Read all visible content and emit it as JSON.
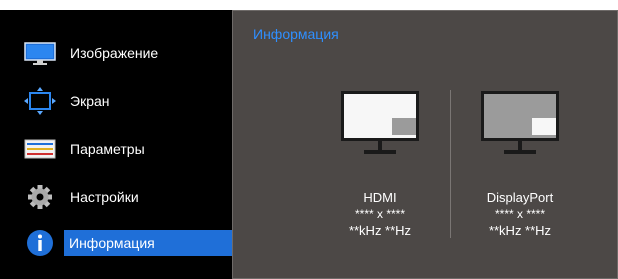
{
  "menu": {
    "items": [
      {
        "label": "Изображение",
        "icon": "display-icon"
      },
      {
        "label": "Экран",
        "icon": "screen-size-icon"
      },
      {
        "label": "Параметры",
        "icon": "settings-sliders-icon"
      },
      {
        "label": "Настройки",
        "icon": "gear-icon"
      },
      {
        "label": "Информация",
        "icon": "info-icon",
        "selected": true
      }
    ]
  },
  "panel": {
    "title": "Информация",
    "sources": [
      {
        "name": "HDMI",
        "resolution": "**** x ****",
        "frequency": "**kHz **Hz"
      },
      {
        "name": "DisplayPort",
        "resolution": "**** x ****",
        "frequency": "**kHz **Hz"
      }
    ]
  },
  "colors": {
    "menu_background": "#000000",
    "panel_background": "#4c4846",
    "accent": "#1f6fd8",
    "title": "#2f8fff"
  }
}
